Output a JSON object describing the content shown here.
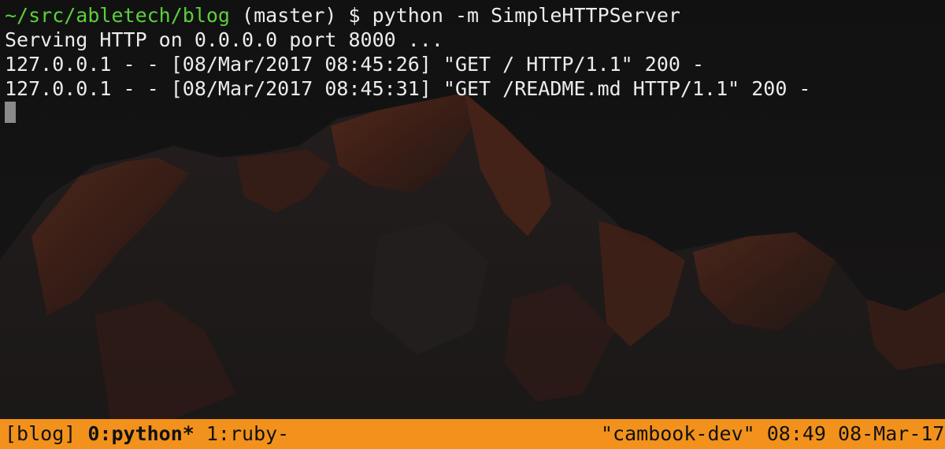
{
  "terminal": {
    "prompt_path": "~/src/abletech/blog",
    "prompt_rest": " (master) $ python -m SimpleHTTPServer",
    "output_lines": [
      "Serving HTTP on 0.0.0.0 port 8000 ...",
      "127.0.0.1 - - [08/Mar/2017 08:45:26] \"GET / HTTP/1.1\" 200 -",
      "127.0.0.1 - - [08/Mar/2017 08:45:31] \"GET /README.md HTTP/1.1\" 200 -"
    ]
  },
  "statusbar": {
    "session": "[blog] ",
    "active_window": "0:python*",
    "inactive_window": " 1:ruby-",
    "right": "\"cambook-dev\" 08:49 08-Mar-17"
  },
  "colors": {
    "prompt_path": "#5ccf3d",
    "statusbar_bg": "#f2921c",
    "text": "#ececec"
  }
}
